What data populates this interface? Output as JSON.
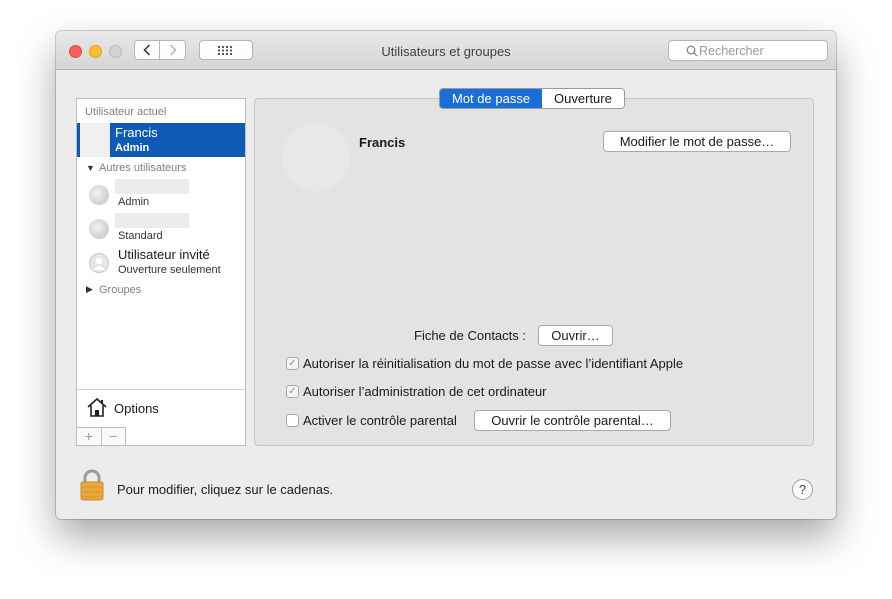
{
  "window": {
    "title": "Utilisateurs et groupes",
    "search_placeholder": "Rechercher"
  },
  "sidebar": {
    "current_user_header": "Utilisateur actuel",
    "current_user": {
      "name": "Francis",
      "role": "Admin"
    },
    "other_users_header": "Autres utilisateurs",
    "other_users": [
      {
        "name": "",
        "role": "Admin"
      },
      {
        "name": "",
        "role": "Standard"
      },
      {
        "name": "Utilisateur invité",
        "role": "Ouverture seulement"
      }
    ],
    "groups_label": "Groupes",
    "options_label": "Options",
    "add_label": "+",
    "remove_label": "−"
  },
  "tabs": [
    {
      "label": "Mot de passe",
      "active": true
    },
    {
      "label": "Ouverture",
      "active": false
    }
  ],
  "main": {
    "user_name": "Francis",
    "change_password_label": "Modifier le mot de passe…",
    "contacts_label": "Fiche de Contacts :",
    "open_contacts_label": "Ouvrir…",
    "checkboxes": [
      {
        "label": "Autoriser la réinitialisation du mot de passe avec l’identifiant Apple",
        "checked": true
      },
      {
        "label": "Autoriser l’administration de cet ordinateur",
        "checked": true
      },
      {
        "label": "Activer le contrôle parental",
        "checked": false
      }
    ],
    "open_parental_label": "Ouvrir le contrôle parental…"
  },
  "footer": {
    "lock_text": "Pour modifier, cliquez sur le cadenas.",
    "help_label": "?"
  }
}
